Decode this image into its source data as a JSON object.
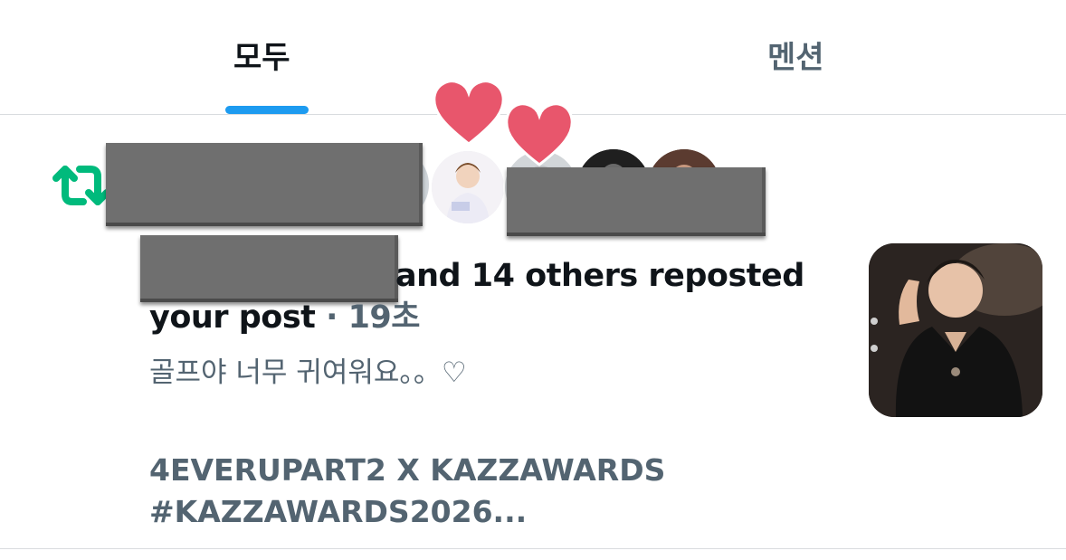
{
  "tabs": {
    "all": "모두",
    "mentions": "멘션"
  },
  "notification": {
    "action": "and 14 others reposted",
    "object": "your post",
    "separator": " · ",
    "time": "19초",
    "post_text": "골프야 너무 귀여워요。。♡",
    "post_title_1": "4EVERUPART2 X KAZZAWARDS",
    "post_title_2": "#KAZZAWARDS2026..."
  },
  "icons": {
    "repost": "repost-icon",
    "heart": "heart-sticker-icon"
  },
  "colors": {
    "accent": "#1d9bf0",
    "repost": "#00ba7c",
    "heart": "#e8566c",
    "muted_text": "#536471",
    "text": "#0f1419"
  }
}
